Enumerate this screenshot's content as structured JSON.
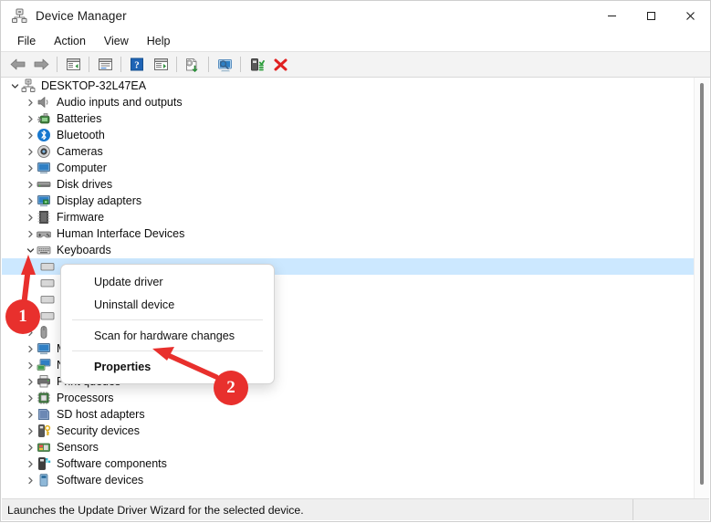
{
  "window": {
    "title": "Device Manager",
    "icon": "device-manager-icon",
    "controls": {
      "minimize": "—",
      "maximize": "□",
      "close": "✕"
    }
  },
  "menubar": {
    "items": [
      {
        "label": "File"
      },
      {
        "label": "Action"
      },
      {
        "label": "View"
      },
      {
        "label": "Help"
      }
    ]
  },
  "toolbar": {
    "buttons": [
      {
        "name": "back-arrow-icon",
        "title": "Back"
      },
      {
        "name": "forward-arrow-icon",
        "title": "Forward"
      },
      {
        "name": "show-hide-console-tree-icon",
        "title": "Show/Hide Console Tree"
      },
      {
        "name": "properties-icon",
        "title": "Properties"
      },
      {
        "name": "help-icon",
        "title": "Help"
      },
      {
        "name": "show-hide-action-pane-icon",
        "title": "Show/Hide Action Pane"
      },
      {
        "name": "update-driver-icon",
        "title": "Update Driver Software"
      },
      {
        "name": "scan-hardware-changes-icon",
        "title": "Scan for hardware changes"
      },
      {
        "name": "enable-device-icon",
        "title": "Enable device"
      },
      {
        "name": "uninstall-device-icon",
        "title": "Uninstall device"
      }
    ]
  },
  "tree": {
    "root": {
      "label": "DESKTOP-32L47EA",
      "icon": "computer-root-icon",
      "expanded": true
    },
    "items": [
      {
        "label": "Audio inputs and outputs",
        "icon": "speaker-icon",
        "expanded": false
      },
      {
        "label": "Batteries",
        "icon": "battery-icon",
        "expanded": false
      },
      {
        "label": "Bluetooth",
        "icon": "bluetooth-icon",
        "expanded": false
      },
      {
        "label": "Cameras",
        "icon": "camera-icon",
        "expanded": false
      },
      {
        "label": "Computer",
        "icon": "monitor-icon",
        "expanded": false
      },
      {
        "label": "Disk drives",
        "icon": "disk-drive-icon",
        "expanded": false
      },
      {
        "label": "Display adapters",
        "icon": "display-adapter-icon",
        "expanded": false
      },
      {
        "label": "Firmware",
        "icon": "firmware-chip-icon",
        "expanded": false
      },
      {
        "label": "Human Interface Devices",
        "icon": "hid-icon",
        "expanded": false
      },
      {
        "label": "Keyboards",
        "icon": "keyboard-icon",
        "expanded": true
      },
      {
        "label": "",
        "icon": "keyboard-device-icon",
        "expanded": false,
        "child": true,
        "selected": true
      },
      {
        "label": "",
        "icon": "keyboard-device-icon",
        "expanded": false,
        "child": true
      },
      {
        "label": "",
        "icon": "keyboard-device-icon",
        "expanded": false,
        "child": true
      },
      {
        "label": "",
        "icon": "keyboard-device-icon",
        "expanded": false,
        "child": true
      },
      {
        "label": "",
        "icon": "mouse-icon",
        "expanded": false
      },
      {
        "label": "Monitors",
        "icon": "monitor-icon",
        "expanded": false
      },
      {
        "label": "Network adapters",
        "icon": "network-adapter-icon",
        "expanded": false
      },
      {
        "label": "Print queues",
        "icon": "printer-icon",
        "expanded": false
      },
      {
        "label": "Processors",
        "icon": "processor-icon",
        "expanded": false
      },
      {
        "label": "SD host adapters",
        "icon": "sd-host-icon",
        "expanded": false
      },
      {
        "label": "Security devices",
        "icon": "security-device-icon",
        "expanded": false
      },
      {
        "label": "Sensors",
        "icon": "sensor-icon",
        "expanded": false
      },
      {
        "label": "Software components",
        "icon": "software-component-icon",
        "expanded": false
      },
      {
        "label": "Software devices",
        "icon": "software-device-icon",
        "expanded": false
      }
    ]
  },
  "context_menu": {
    "items": [
      {
        "label": "Update driver",
        "bold": false
      },
      {
        "label": "Uninstall device",
        "bold": false
      },
      {
        "separator": true
      },
      {
        "label": "Scan for hardware changes",
        "bold": false
      },
      {
        "separator": true
      },
      {
        "label": "Properties",
        "bold": true
      }
    ]
  },
  "annotations": [
    {
      "number": "1",
      "target": "keyboards-expand-chevron"
    },
    {
      "number": "2",
      "target": "properties-menu-item"
    }
  ],
  "statusbar": {
    "text": "Launches the Update Driver Wizard for the selected device."
  },
  "colors": {
    "accent_red": "#e8302d",
    "selection_blue": "#cce8ff",
    "toolbar_bg": "#f3f3f3",
    "statusbar_bg": "#efefef"
  }
}
